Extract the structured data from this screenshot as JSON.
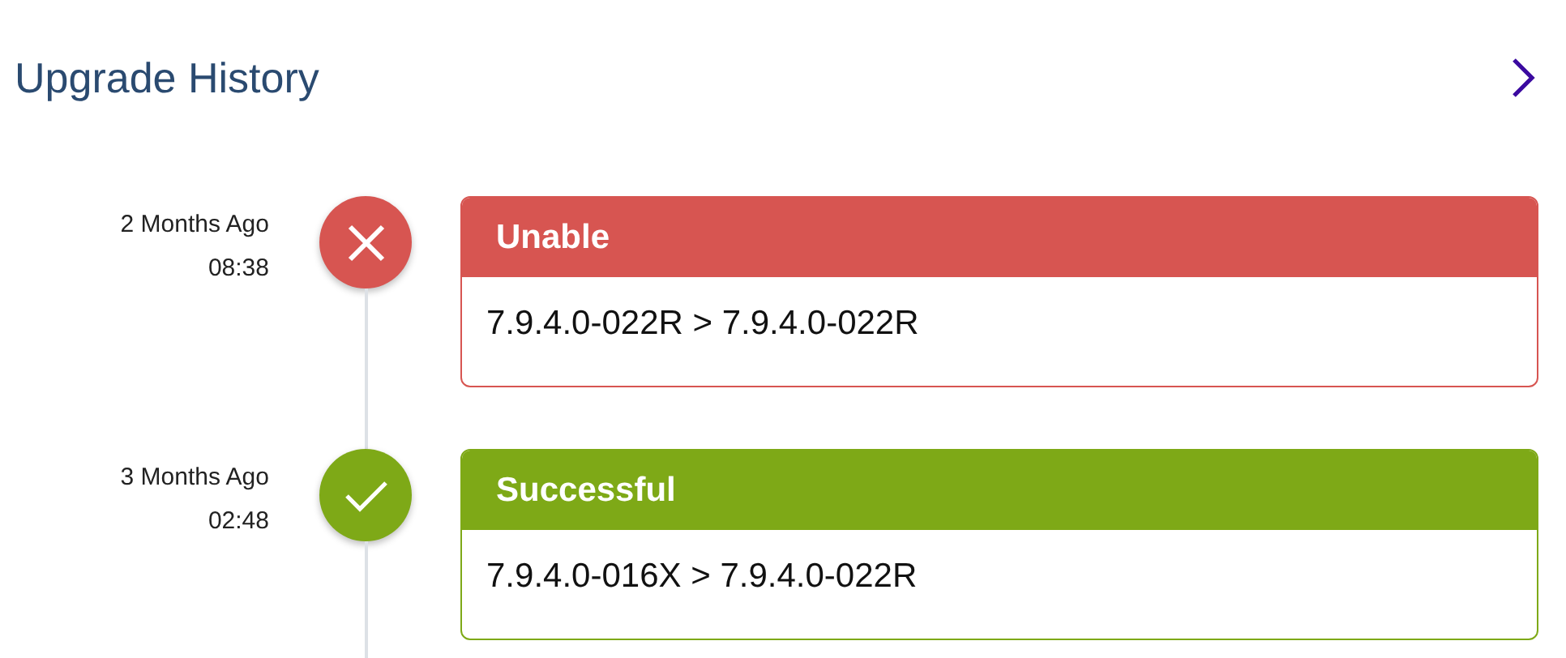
{
  "title": "Upgrade History",
  "entries": [
    {
      "ago": "2 Months Ago",
      "time": "08:38",
      "kind": "failed",
      "status": "Unable",
      "versions": "7.9.4.0-022R > 7.9.4.0-022R"
    },
    {
      "ago": "3 Months Ago",
      "time": "02:48",
      "kind": "success",
      "status": "Successful",
      "versions": "7.9.4.0-016X > 7.9.4.0-022R"
    }
  ]
}
